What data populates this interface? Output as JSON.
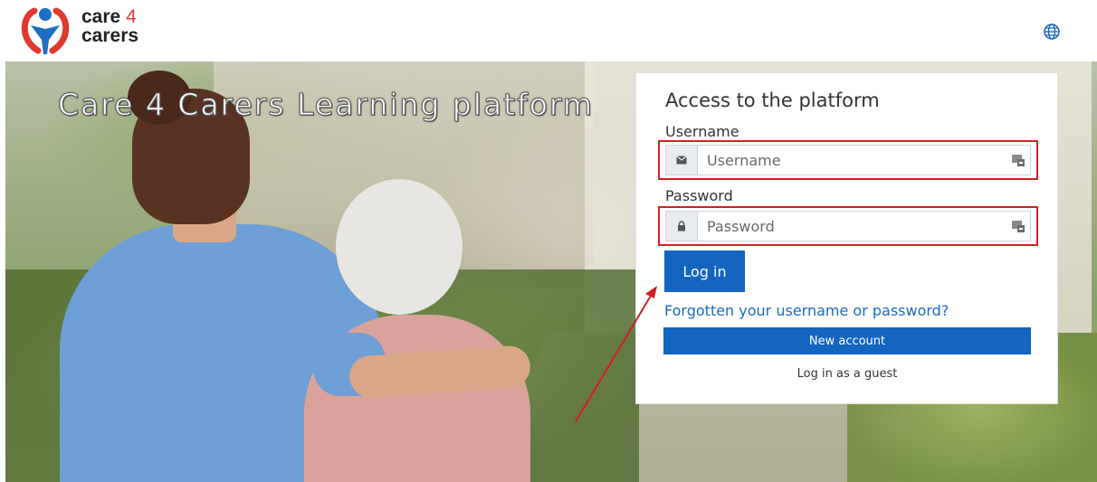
{
  "header": {
    "logo_line1": "care",
    "logo_four": "4",
    "logo_line2": "carers",
    "language_icon": "globe-icon"
  },
  "hero": {
    "title": "Care 4 Carers Learning platform"
  },
  "login": {
    "title": "Access to the platform",
    "username_label": "Username",
    "username_placeholder": "Username",
    "username_icon": "envelope-icon",
    "password_label": "Password",
    "password_placeholder": "Password",
    "password_icon": "lock-icon",
    "keypass_icon": "password-manager-icon",
    "login_button": "Log in",
    "forgot_link": "Forgotten your username or password?",
    "new_account_button": "New account",
    "guest_link": "Log in as a guest"
  },
  "colors": {
    "primary": "#1465c0",
    "link": "#1a6bc4",
    "highlight": "#d42020",
    "brand_red": "#e0382f",
    "brand_blue": "#1e6fc4"
  }
}
